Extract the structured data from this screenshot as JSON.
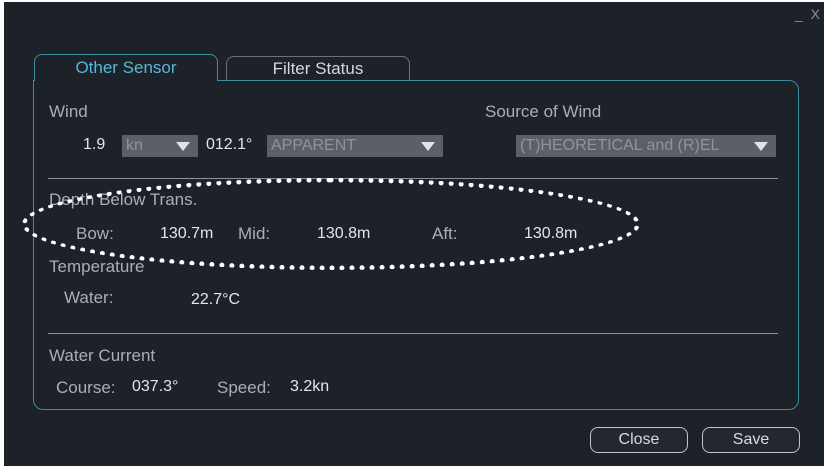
{
  "window": {
    "controls": "_ X"
  },
  "tabs": [
    {
      "label": "Other Sensor"
    },
    {
      "label": "Filter Status"
    }
  ],
  "wind": {
    "title": "Wind",
    "speed_value": "1.9",
    "speed_unit": "kn",
    "direction_value": "012.1°",
    "mode": "APPARENT",
    "source_title": "Source of Wind",
    "source_value": "(T)HEORETICAL and (R)EL"
  },
  "depth": {
    "title": "Depth Below Trans.",
    "bow_label": "Bow:",
    "bow_value": "130.7m",
    "mid_label": "Mid:",
    "mid_value": "130.8m",
    "aft_label": "Aft:",
    "aft_value": "130.8m"
  },
  "temperature": {
    "title": "Temperature",
    "water_label": "Water:",
    "water_value": "22.7°C"
  },
  "current": {
    "title": "Water Current",
    "course_label": "Course:",
    "course_value": "037.3°",
    "speed_label": "Speed:",
    "speed_value": "3.2kn"
  },
  "buttons": {
    "close": "Close",
    "save": "Save"
  },
  "colors": {
    "background": "#1d2128",
    "accent": "#55b9d6",
    "panel_border": "#3c8fa3",
    "dropdown": "#5b6068"
  }
}
